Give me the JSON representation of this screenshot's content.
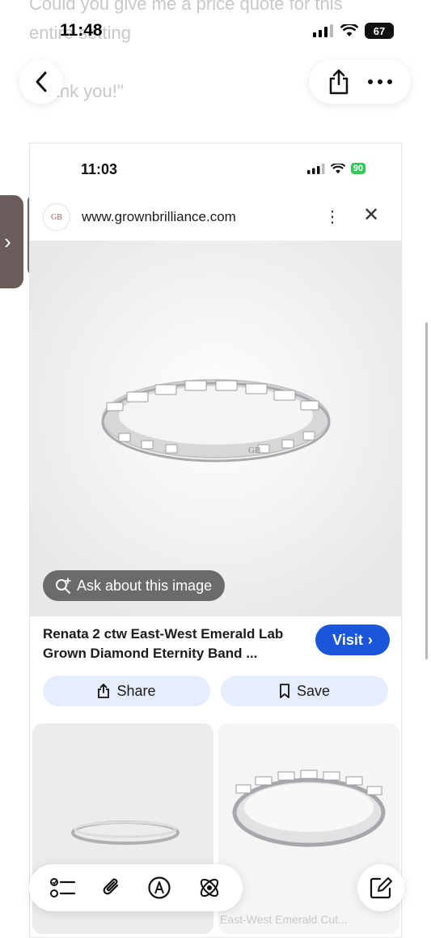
{
  "background_message": {
    "line1": "Could you give me a price quote for this",
    "line2": "entire setting",
    "line3": "Thank you!\""
  },
  "status_bar": {
    "time": "11:48",
    "battery": "67"
  },
  "nav": {
    "back_icon": "chevron-left-icon",
    "share_icon": "share-icon",
    "more_icon": "more-horizontal-icon"
  },
  "screenshot": {
    "status_time": "11:03",
    "battery": "90",
    "url": "www.grownbrilliance.com",
    "site_logo": "GB",
    "ask_label": "Ask about this image",
    "product_title": "Renata 2 ctw East-West Emerald Lab Grown Diamond Eternity Band ...",
    "visit_label": "Visit",
    "share_label": "Share",
    "save_label": "Save",
    "engraving": "GB",
    "thumb_caption": "East-West Emerald Cut..."
  },
  "toolbar": {
    "icons": [
      "checklist-icon",
      "paperclip-icon",
      "markup-icon",
      "ai-icon"
    ],
    "compose_icon": "compose-icon"
  },
  "colors": {
    "visit_blue": "#1a56db",
    "action_bg": "#e6edfc",
    "battery_green": "#34c759"
  }
}
